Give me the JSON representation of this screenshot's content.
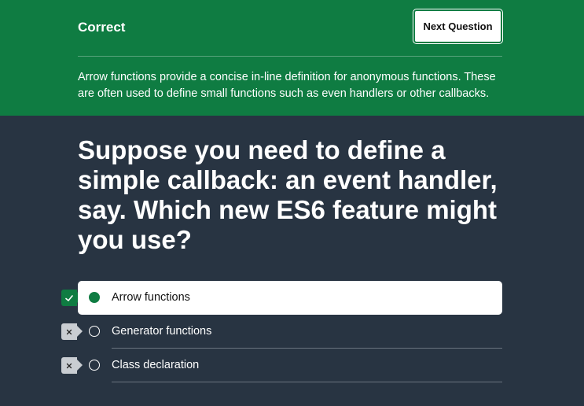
{
  "feedback": {
    "status": "Correct",
    "next_button": "Next Question",
    "explanation": "Arrow functions provide a concise in-line definition for anonymous functions. These are often used to define small functions such as even handlers or other callbacks."
  },
  "question": {
    "text": "Suppose you need to define a simple callback: an event handler, say. Which new ES6 feature might you use?"
  },
  "options": [
    {
      "label": "Arrow functions",
      "result": "correct",
      "selected": true
    },
    {
      "label": "Generator functions",
      "result": "wrong",
      "selected": false
    },
    {
      "label": "Class declaration",
      "result": "wrong",
      "selected": false
    }
  ],
  "colors": {
    "correct_green": "#0f7c42",
    "background": "#283442",
    "wrong_marker": "#c9cdd2"
  },
  "icons": {
    "correct": "checkmark-icon",
    "wrong": "x-mark-icon"
  }
}
